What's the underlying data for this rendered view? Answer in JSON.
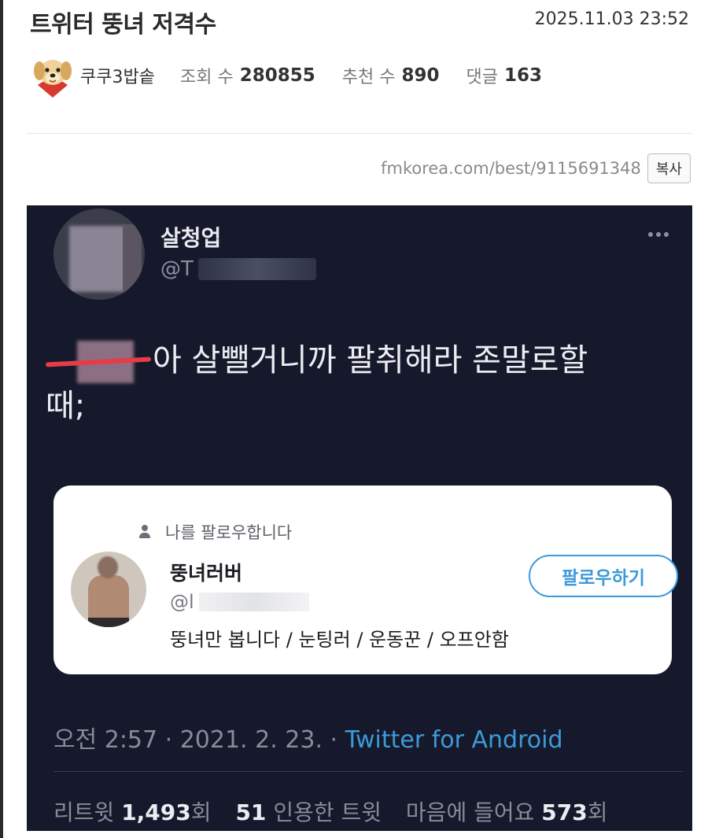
{
  "post": {
    "title": "트위터 뚱녀 저격수",
    "date": "2025.11.03 23:52",
    "author": "쿠쿠3밥솥",
    "views_label": "조회 수",
    "views": "280855",
    "recommend_label": "추천 수",
    "recommend": "890",
    "comments_label": "댓글",
    "comments": "163",
    "url": "fmkorea.com/best/9115691348",
    "copy_label": "복사"
  },
  "tweet": {
    "display_name": "살청업",
    "handle": "@T",
    "body_after_redaction": "아 살뺄거니까 팔취해라 존말로할",
    "body_line2": "때;",
    "follow_card": {
      "notice": "나를 팔로우합니다",
      "name": "뚱녀러버",
      "handle": "@l",
      "bio": "뚱녀만 봅니다 / 눈팅러 / 운동꾼 / 오프안함",
      "follow_button": "팔로우하기"
    },
    "time": "오전 2:57 · 2021. 2. 23. · ",
    "source": "Twitter for Android",
    "stats": {
      "retweet_label": "리트윗",
      "retweets": "1,493",
      "times_unit": "회",
      "quotes": "51",
      "quote_label": "인용한 트윗",
      "likes_label": "마음에 들어요",
      "likes": "573"
    }
  },
  "colors": {
    "tweet_background": "#15192b",
    "link_blue": "#3d9ad9",
    "strike_red": "#e53c45"
  },
  "icons": [
    "dog-avatar-icon",
    "more-dots-icon",
    "person-icon"
  ]
}
